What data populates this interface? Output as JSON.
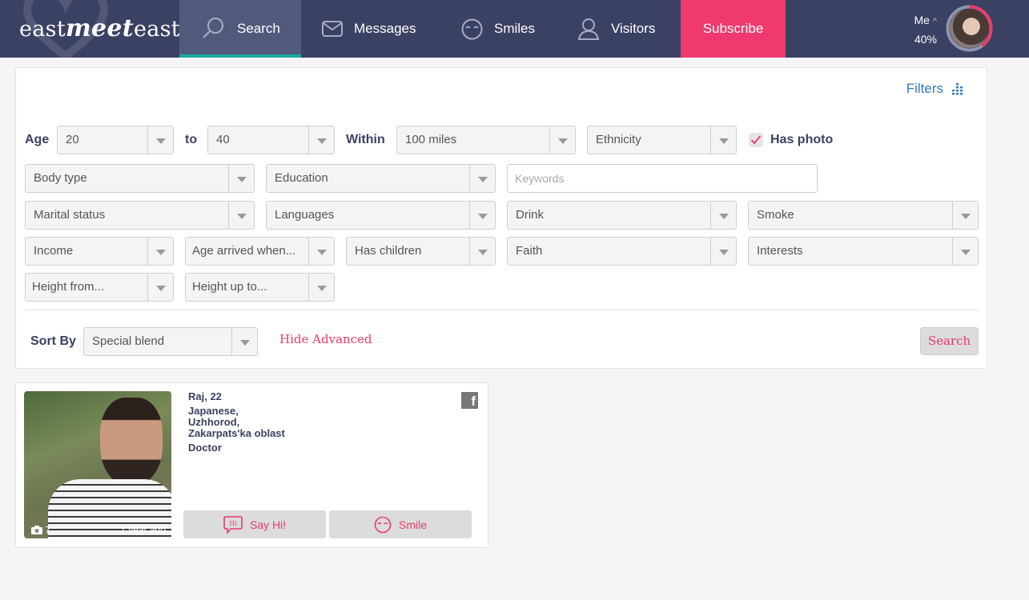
{
  "nav": {
    "logo": {
      "part1": "east",
      "part2": "meet",
      "part3": "east"
    },
    "items": [
      {
        "label": "Search",
        "icon": "search-icon",
        "active": true
      },
      {
        "label": "Messages",
        "icon": "envelope-icon"
      },
      {
        "label": "Smiles",
        "icon": "smile-icon"
      },
      {
        "label": "Visitors",
        "icon": "user-icon"
      }
    ],
    "subscribe_label": "Subscribe",
    "me_label": "Me",
    "me_caret": "^",
    "profile_completion": "40%",
    "profile_completion_fraction": 0.4
  },
  "colors": {
    "nav_bg": "#3b4163",
    "active_tab": "#525a7c",
    "active_underline": "#1aaaa0",
    "accent_pink": "#ef3a6e",
    "link_blue": "#2f7bbf"
  },
  "filters": {
    "filters_link": "Filters",
    "age_label": "Age",
    "age_from": "20",
    "to_label": "to",
    "age_to": "40",
    "within_label": "Within",
    "within_value": "100 miles",
    "ethnicity": "Ethnicity",
    "has_photo_label": "Has photo",
    "has_photo_checked": true,
    "body_type": "Body type",
    "education": "Education",
    "keywords_placeholder": "Keywords",
    "keywords_value": "",
    "marital_status": "Marital status",
    "languages": "Languages",
    "drink": "Drink",
    "smoke": "Smoke",
    "income": "Income",
    "age_arrived": "Age arrived when...",
    "has_children": "Has children",
    "faith": "Faith",
    "interests": "Interests",
    "height_from": "Height from...",
    "height_to": "Height up to...",
    "sort_by_label": "Sort By",
    "sort_by_value": "Special blend",
    "hide_advanced": "Hide Advanced",
    "search_button": "Search"
  },
  "results": [
    {
      "name_age": "Raj, 22",
      "location_lines": [
        "Japanese,",
        "Uzhhorod,",
        "Zakarpats'ka oblast"
      ],
      "occupation": "Doctor",
      "photo_count": "7",
      "last_active": "1 year ago",
      "say_hi_label": "Say Hi!",
      "smile_label": "Smile",
      "hi_badge": "Hi",
      "facebook_glyph": "f"
    }
  ]
}
